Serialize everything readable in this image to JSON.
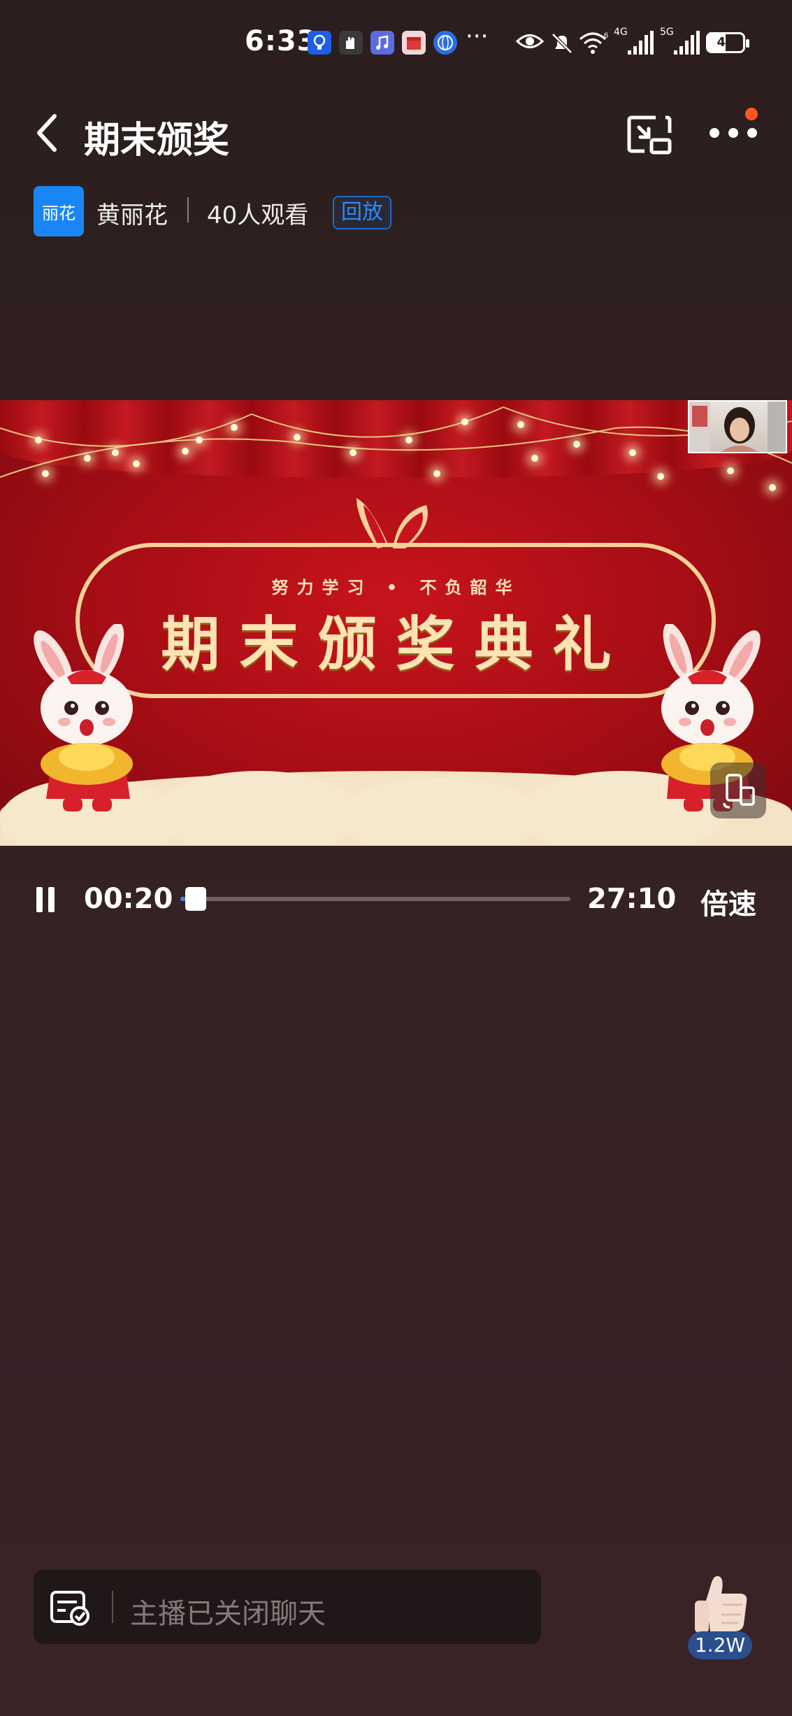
{
  "status_bar": {
    "time": "6:33",
    "battery": "49",
    "network_1": "4G",
    "network_2": "5G",
    "wifi_badge": "6",
    "overflow": "···"
  },
  "header": {
    "title": "期末颁奖"
  },
  "host": {
    "avatar_text": "丽花",
    "name": "黄丽花",
    "viewers": "40人观看",
    "replay_label": "回放"
  },
  "video": {
    "subtitle": "努力学习 • 不负韶华",
    "title": "期末颁奖典礼"
  },
  "playback": {
    "current_time": "00:20",
    "duration": "27:10",
    "progress_fraction": 0.012,
    "speed_label": "倍速"
  },
  "chat": {
    "placeholder": "主播已关闭聊天"
  },
  "like": {
    "count": "1.2W"
  },
  "colors": {
    "accent_blue": "#2a8cff",
    "notif_dot": "#ff5722",
    "banner_gold": "#fbe3b4",
    "video_red": "#b3101a"
  }
}
